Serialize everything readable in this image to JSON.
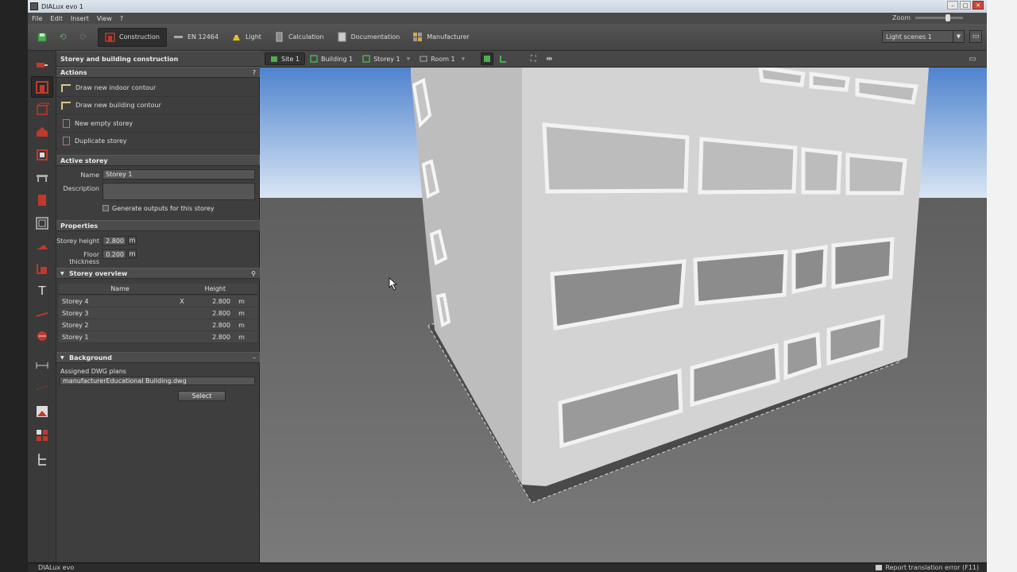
{
  "window": {
    "title": "DIALux evo 1"
  },
  "menu": {
    "items": [
      "File",
      "Edit",
      "Insert",
      "View",
      "?"
    ],
    "zoom_label": "Zoom"
  },
  "toolbar": {
    "tabs": [
      {
        "label": "Construction",
        "icon": "construction-icon",
        "active": true
      },
      {
        "label": "EN 12464",
        "icon": "en12464-icon",
        "active": false
      },
      {
        "label": "Light",
        "icon": "light-icon",
        "active": false
      },
      {
        "label": "Calculation",
        "icon": "calculation-icon",
        "active": false
      },
      {
        "label": "Documentation",
        "icon": "documentation-icon",
        "active": false
      },
      {
        "label": "Manufacturer",
        "icon": "manufacturer-icon",
        "active": false
      }
    ],
    "light_scene": "Light scenes 1"
  },
  "panel": {
    "title": "Storey and building construction",
    "actions_header": "Actions",
    "help": "?",
    "actions": [
      "Draw new indoor contour",
      "Draw new building contour",
      "New empty storey",
      "Duplicate storey"
    ],
    "active_storey_header": "Active storey",
    "name_label": "Name",
    "name_value": "Storey 1",
    "description_label": "Description",
    "description_value": "",
    "generate_outputs_label": "Generate outputs for this storey",
    "properties_header": "Properties",
    "storey_height_label": "Storey height",
    "storey_height_value": "2.800",
    "floor_thickness_label": "Floor thickness",
    "floor_thickness_value": "0.200",
    "unit": "m",
    "storey_overview_header": "Storey overview",
    "table": {
      "col_name": "Name",
      "col_height": "Height",
      "rows": [
        {
          "name": "Storey 4",
          "x": "X",
          "height": "2.800",
          "unit": "m"
        },
        {
          "name": "Storey 3",
          "x": "",
          "height": "2.800",
          "unit": "m"
        },
        {
          "name": "Storey 2",
          "x": "",
          "height": "2.800",
          "unit": "m"
        },
        {
          "name": "Storey 1",
          "x": "",
          "height": "2.800",
          "unit": "m"
        }
      ]
    },
    "background_header": "Background",
    "assigned_dwg_label": "Assigned DWG plans",
    "dwg_value": "manufacturerEducational Building.dwg",
    "select_label": "Select"
  },
  "view": {
    "breadcrumbs": [
      "Site 1",
      "Building 1",
      "Storey 1",
      "Room 1"
    ]
  },
  "status": {
    "left": "DIALux evo",
    "right": "Report translation error (F11)"
  },
  "colors": {
    "accent_red": "#c0392b",
    "sky_top": "#5b8fd6",
    "ground": "#6e6e6e",
    "building": "#d6d6d6"
  }
}
